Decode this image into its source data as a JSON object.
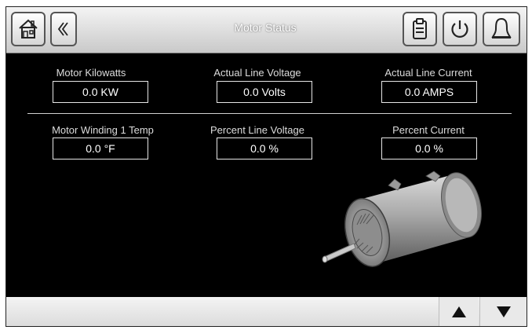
{
  "header": {
    "title": "Motor Status"
  },
  "icons": {
    "home": "home-icon",
    "back": "chevron-left-icon",
    "log": "document-icon",
    "power": "power-icon",
    "alarm": "bell-icon"
  },
  "fields": {
    "motor_kw": {
      "label": "Motor Kilowatts",
      "value": "0.0 KW"
    },
    "line_voltage": {
      "label": "Actual Line Voltage",
      "value": "0.0 Volts"
    },
    "line_current": {
      "label": "Actual Line Current",
      "value": "0.0 AMPS"
    },
    "winding_temp": {
      "label": "Motor Winding 1 Temp",
      "value": "0.0 °F"
    },
    "percent_voltage": {
      "label": "Percent Line Voltage",
      "value": "0.0 %"
    },
    "percent_current": {
      "label": "Percent Current",
      "value": "0.0 %"
    }
  },
  "colors": {
    "background": "#000000",
    "bar": "#e0e0e0",
    "text": "#ffffff"
  }
}
